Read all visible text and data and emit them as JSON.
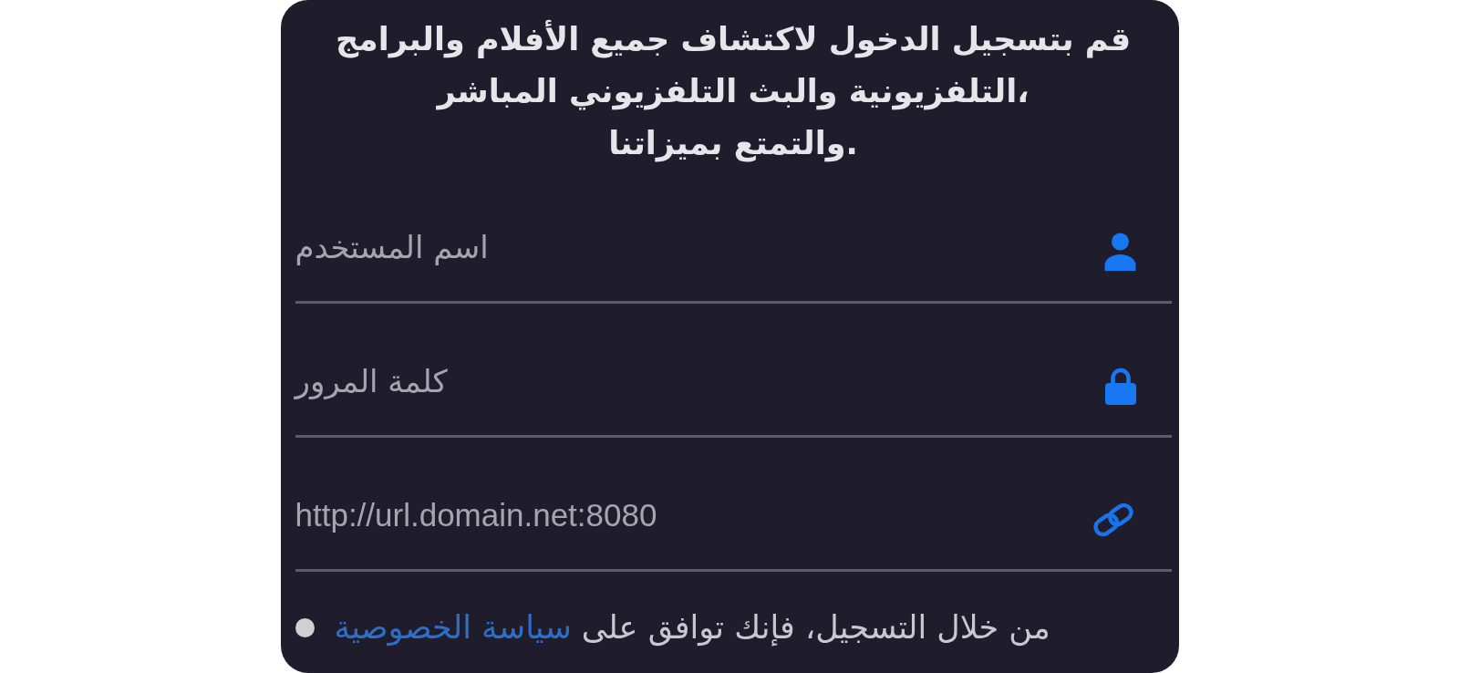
{
  "intro": "قم بتسجيل الدخول لاكتشاف جميع الأفلام والبرامج\nالتلفزيونية والبث التلفزيوني المباشر،\nوالتمتع بميزاتنا.",
  "fields": [
    {
      "kind": "username",
      "placeholder": "اسم المستخدم"
    },
    {
      "kind": "password",
      "placeholder": "كلمة المرور"
    },
    {
      "kind": "url",
      "placeholder": "http://url.domain.net:8080"
    }
  ],
  "terms": {
    "checked": false,
    "text": "من خلال التسجيل، فإنك توافق على",
    "link": "سياسة الخصوصية"
  }
}
